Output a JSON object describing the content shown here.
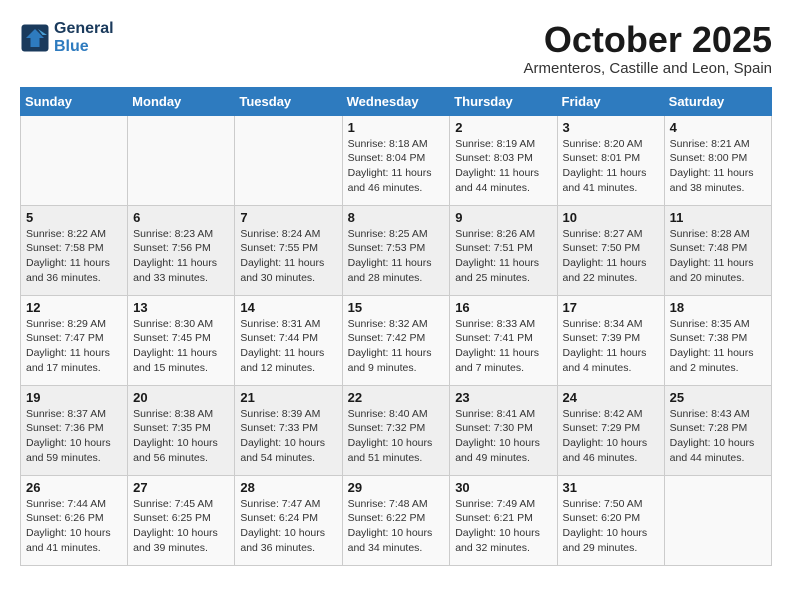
{
  "header": {
    "logo_line1": "General",
    "logo_line2": "Blue",
    "month": "October 2025",
    "location": "Armenteros, Castille and Leon, Spain"
  },
  "weekdays": [
    "Sunday",
    "Monday",
    "Tuesday",
    "Wednesday",
    "Thursday",
    "Friday",
    "Saturday"
  ],
  "weeks": [
    [
      {
        "day": "",
        "info": ""
      },
      {
        "day": "",
        "info": ""
      },
      {
        "day": "",
        "info": ""
      },
      {
        "day": "1",
        "info": "Sunrise: 8:18 AM\nSunset: 8:04 PM\nDaylight: 11 hours and 46 minutes."
      },
      {
        "day": "2",
        "info": "Sunrise: 8:19 AM\nSunset: 8:03 PM\nDaylight: 11 hours and 44 minutes."
      },
      {
        "day": "3",
        "info": "Sunrise: 8:20 AM\nSunset: 8:01 PM\nDaylight: 11 hours and 41 minutes."
      },
      {
        "day": "4",
        "info": "Sunrise: 8:21 AM\nSunset: 8:00 PM\nDaylight: 11 hours and 38 minutes."
      }
    ],
    [
      {
        "day": "5",
        "info": "Sunrise: 8:22 AM\nSunset: 7:58 PM\nDaylight: 11 hours and 36 minutes."
      },
      {
        "day": "6",
        "info": "Sunrise: 8:23 AM\nSunset: 7:56 PM\nDaylight: 11 hours and 33 minutes."
      },
      {
        "day": "7",
        "info": "Sunrise: 8:24 AM\nSunset: 7:55 PM\nDaylight: 11 hours and 30 minutes."
      },
      {
        "day": "8",
        "info": "Sunrise: 8:25 AM\nSunset: 7:53 PM\nDaylight: 11 hours and 28 minutes."
      },
      {
        "day": "9",
        "info": "Sunrise: 8:26 AM\nSunset: 7:51 PM\nDaylight: 11 hours and 25 minutes."
      },
      {
        "day": "10",
        "info": "Sunrise: 8:27 AM\nSunset: 7:50 PM\nDaylight: 11 hours and 22 minutes."
      },
      {
        "day": "11",
        "info": "Sunrise: 8:28 AM\nSunset: 7:48 PM\nDaylight: 11 hours and 20 minutes."
      }
    ],
    [
      {
        "day": "12",
        "info": "Sunrise: 8:29 AM\nSunset: 7:47 PM\nDaylight: 11 hours and 17 minutes."
      },
      {
        "day": "13",
        "info": "Sunrise: 8:30 AM\nSunset: 7:45 PM\nDaylight: 11 hours and 15 minutes."
      },
      {
        "day": "14",
        "info": "Sunrise: 8:31 AM\nSunset: 7:44 PM\nDaylight: 11 hours and 12 minutes."
      },
      {
        "day": "15",
        "info": "Sunrise: 8:32 AM\nSunset: 7:42 PM\nDaylight: 11 hours and 9 minutes."
      },
      {
        "day": "16",
        "info": "Sunrise: 8:33 AM\nSunset: 7:41 PM\nDaylight: 11 hours and 7 minutes."
      },
      {
        "day": "17",
        "info": "Sunrise: 8:34 AM\nSunset: 7:39 PM\nDaylight: 11 hours and 4 minutes."
      },
      {
        "day": "18",
        "info": "Sunrise: 8:35 AM\nSunset: 7:38 PM\nDaylight: 11 hours and 2 minutes."
      }
    ],
    [
      {
        "day": "19",
        "info": "Sunrise: 8:37 AM\nSunset: 7:36 PM\nDaylight: 10 hours and 59 minutes."
      },
      {
        "day": "20",
        "info": "Sunrise: 8:38 AM\nSunset: 7:35 PM\nDaylight: 10 hours and 56 minutes."
      },
      {
        "day": "21",
        "info": "Sunrise: 8:39 AM\nSunset: 7:33 PM\nDaylight: 10 hours and 54 minutes."
      },
      {
        "day": "22",
        "info": "Sunrise: 8:40 AM\nSunset: 7:32 PM\nDaylight: 10 hours and 51 minutes."
      },
      {
        "day": "23",
        "info": "Sunrise: 8:41 AM\nSunset: 7:30 PM\nDaylight: 10 hours and 49 minutes."
      },
      {
        "day": "24",
        "info": "Sunrise: 8:42 AM\nSunset: 7:29 PM\nDaylight: 10 hours and 46 minutes."
      },
      {
        "day": "25",
        "info": "Sunrise: 8:43 AM\nSunset: 7:28 PM\nDaylight: 10 hours and 44 minutes."
      }
    ],
    [
      {
        "day": "26",
        "info": "Sunrise: 7:44 AM\nSunset: 6:26 PM\nDaylight: 10 hours and 41 minutes."
      },
      {
        "day": "27",
        "info": "Sunrise: 7:45 AM\nSunset: 6:25 PM\nDaylight: 10 hours and 39 minutes."
      },
      {
        "day": "28",
        "info": "Sunrise: 7:47 AM\nSunset: 6:24 PM\nDaylight: 10 hours and 36 minutes."
      },
      {
        "day": "29",
        "info": "Sunrise: 7:48 AM\nSunset: 6:22 PM\nDaylight: 10 hours and 34 minutes."
      },
      {
        "day": "30",
        "info": "Sunrise: 7:49 AM\nSunset: 6:21 PM\nDaylight: 10 hours and 32 minutes."
      },
      {
        "day": "31",
        "info": "Sunrise: 7:50 AM\nSunset: 6:20 PM\nDaylight: 10 hours and 29 minutes."
      },
      {
        "day": "",
        "info": ""
      }
    ]
  ]
}
